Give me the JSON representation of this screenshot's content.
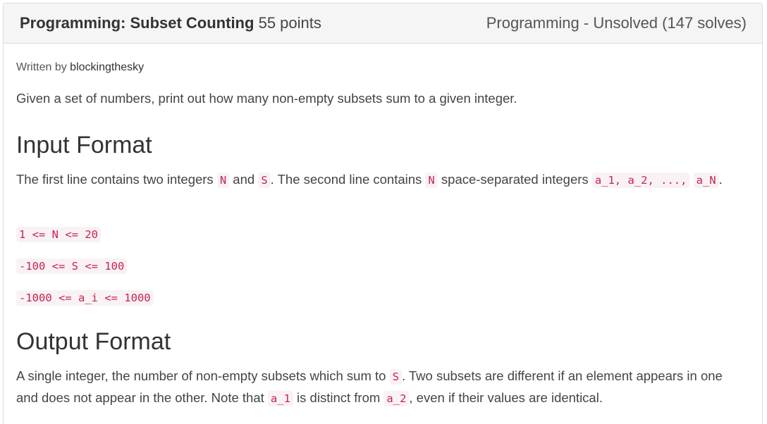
{
  "header": {
    "title": "Programming: Subset Counting",
    "points": "55 points",
    "status": "Programming - Unsolved (147 solves)"
  },
  "author": {
    "prefix": "Written by ",
    "name": "blockingthesky"
  },
  "description": "Given a set of numbers, print out how many non-empty subsets sum to a given integer.",
  "input_section": {
    "heading": "Input Format",
    "text_1": "The first line contains two integers ",
    "code_n": "N",
    "text_2": " and ",
    "code_s": "S",
    "text_3": ". The second line contains ",
    "code_n2": "N",
    "text_4": " space-separated integers ",
    "code_list": "a_1, a_2, ...,",
    "code_last": "a_N",
    "text_5": ".",
    "constraints": [
      "1 <= N <= 20",
      "-100 <= S <= 100",
      "-1000 <= a_i <= 1000"
    ]
  },
  "output_section": {
    "heading": "Output Format",
    "text_1": "A single integer, the number of non-empty subsets which sum to ",
    "code_s": "S",
    "text_2": ". Two subsets are different if an element appears in one and does not appear in the other. Note that ",
    "code_a1": "a_1",
    "text_3": " is distinct from ",
    "code_a2": "a_2",
    "text_4": ", even if their values are identical."
  }
}
